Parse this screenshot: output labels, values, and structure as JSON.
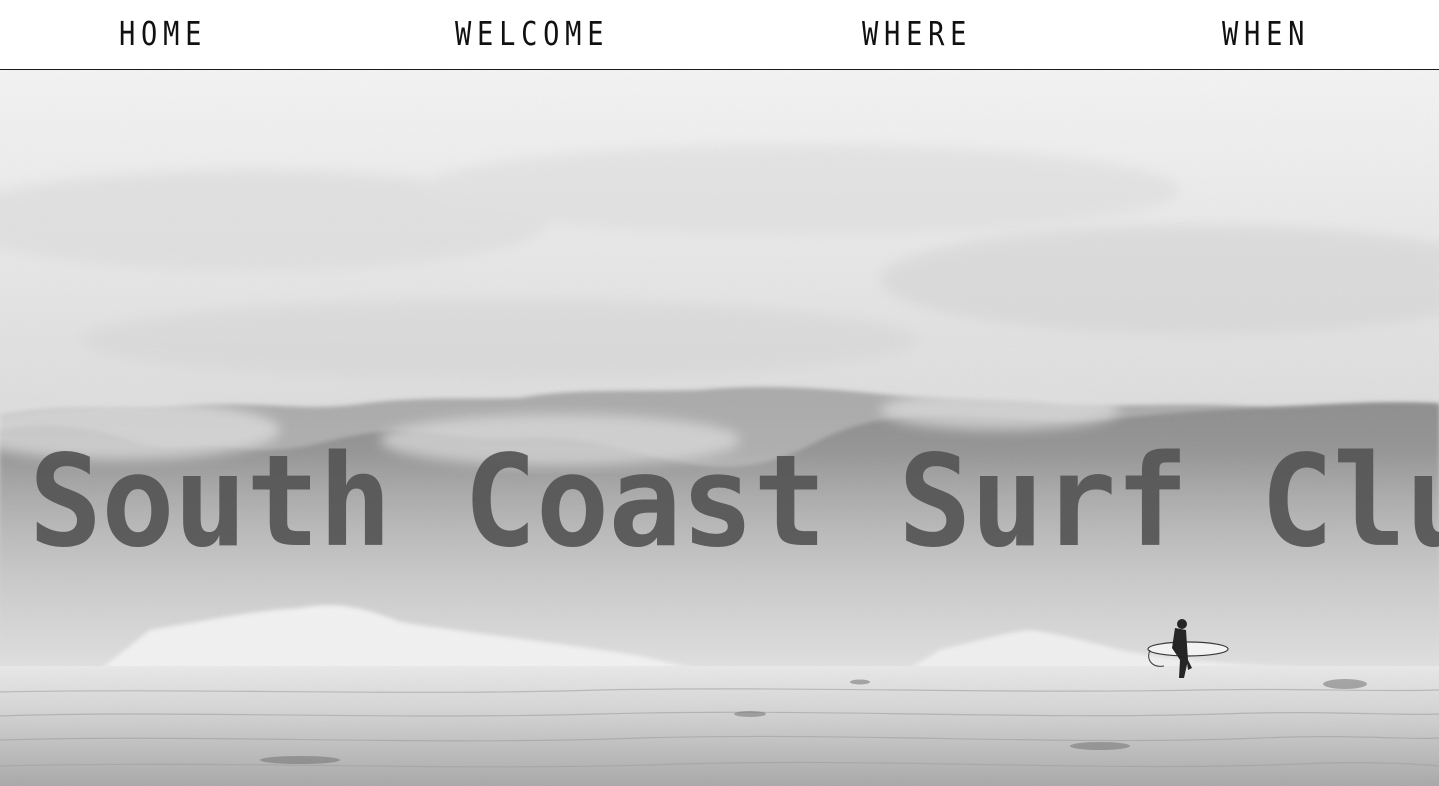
{
  "nav": {
    "items": [
      {
        "label": "HOME"
      },
      {
        "label": "WELCOME"
      },
      {
        "label": "WHERE"
      },
      {
        "label": "WHEN"
      }
    ]
  },
  "hero": {
    "title": "South Coast Surf Club",
    "image": "black-and-white photo of misty forested hills over surf with a lone surfer carrying a board"
  },
  "colors": {
    "nav_background": "#ffffff",
    "nav_text": "#111111",
    "nav_border": "#1a1a1a",
    "title_text": "#555555"
  }
}
